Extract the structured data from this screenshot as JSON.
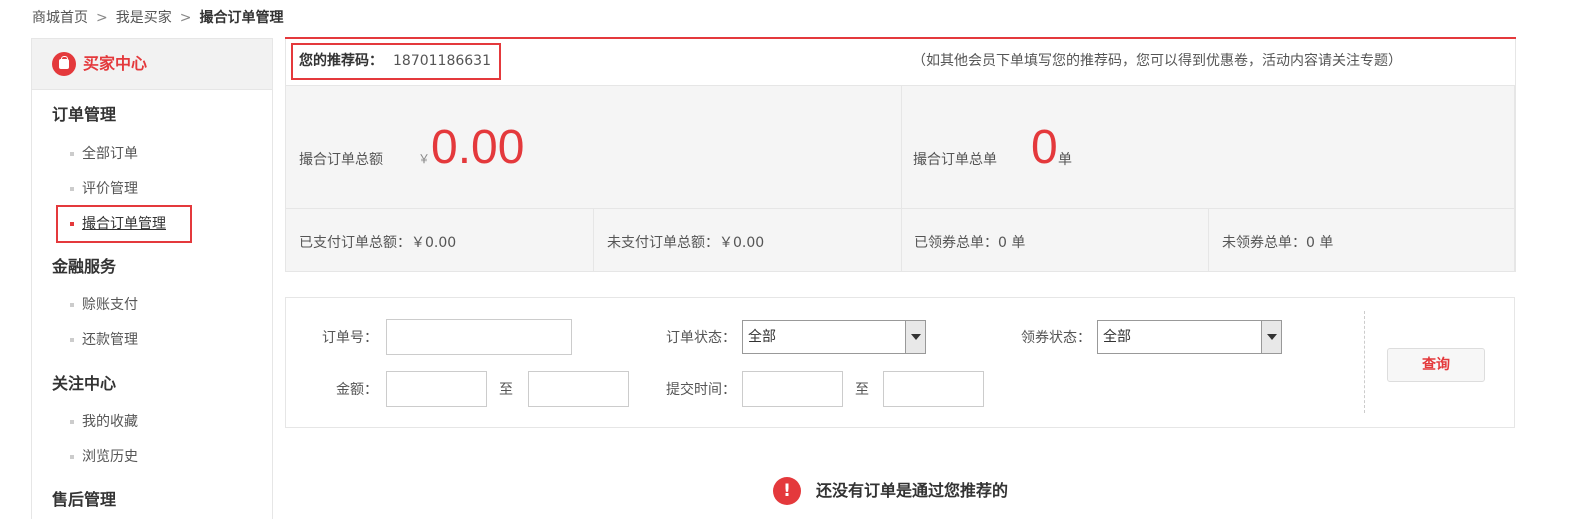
{
  "breadcrumb": {
    "home": "商城首页",
    "buyer": "我是买家",
    "current": "撮合订单管理",
    "separator": ">"
  },
  "sidebar": {
    "title": "买家中心",
    "groups": [
      {
        "title": "订单管理",
        "items": [
          "全部订单",
          "评价管理",
          "撮合订单管理"
        ]
      },
      {
        "title": "金融服务",
        "items": [
          "赊账支付",
          "还款管理"
        ]
      },
      {
        "title": "关注中心",
        "items": [
          "我的收藏",
          "浏览历史"
        ]
      },
      {
        "title": "售后管理",
        "items": []
      }
    ],
    "active_item": "撮合订单管理"
  },
  "referral": {
    "label": "您的推荐码：",
    "code": "18701186631",
    "note": "（如其他会员下单填写您的推荐码，您可以得到优惠卷，活动内容请关注专题）"
  },
  "stats": {
    "total_amount_label": "撮合订单总额",
    "total_amount_currency": "￥",
    "total_amount_value": "0.00",
    "total_orders_label": "撮合订单总单",
    "total_orders_value": "0",
    "total_orders_unit": "单",
    "paid_amount": "已支付订单总额：￥0.00",
    "unpaid_amount": "未支付订单总额：￥0.00",
    "claimed_coupons": "已领券总单：0 单",
    "unclaimed_coupons": "未领券总单：0 单"
  },
  "search": {
    "order_no_label": "订单号：",
    "order_status_label": "订单状态：",
    "order_status_value": "全部",
    "coupon_status_label": "领券状态：",
    "coupon_status_value": "全部",
    "amount_label": "金额：",
    "to": "至",
    "submit_time_label": "提交时间：",
    "query_button": "查询"
  },
  "empty": {
    "icon": "!",
    "message": "还没有订单是通过您推荐的"
  },
  "colors": {
    "accent": "#e4393c",
    "panel_bg": "#f5f5f5",
    "border": "#e6e6e6"
  }
}
